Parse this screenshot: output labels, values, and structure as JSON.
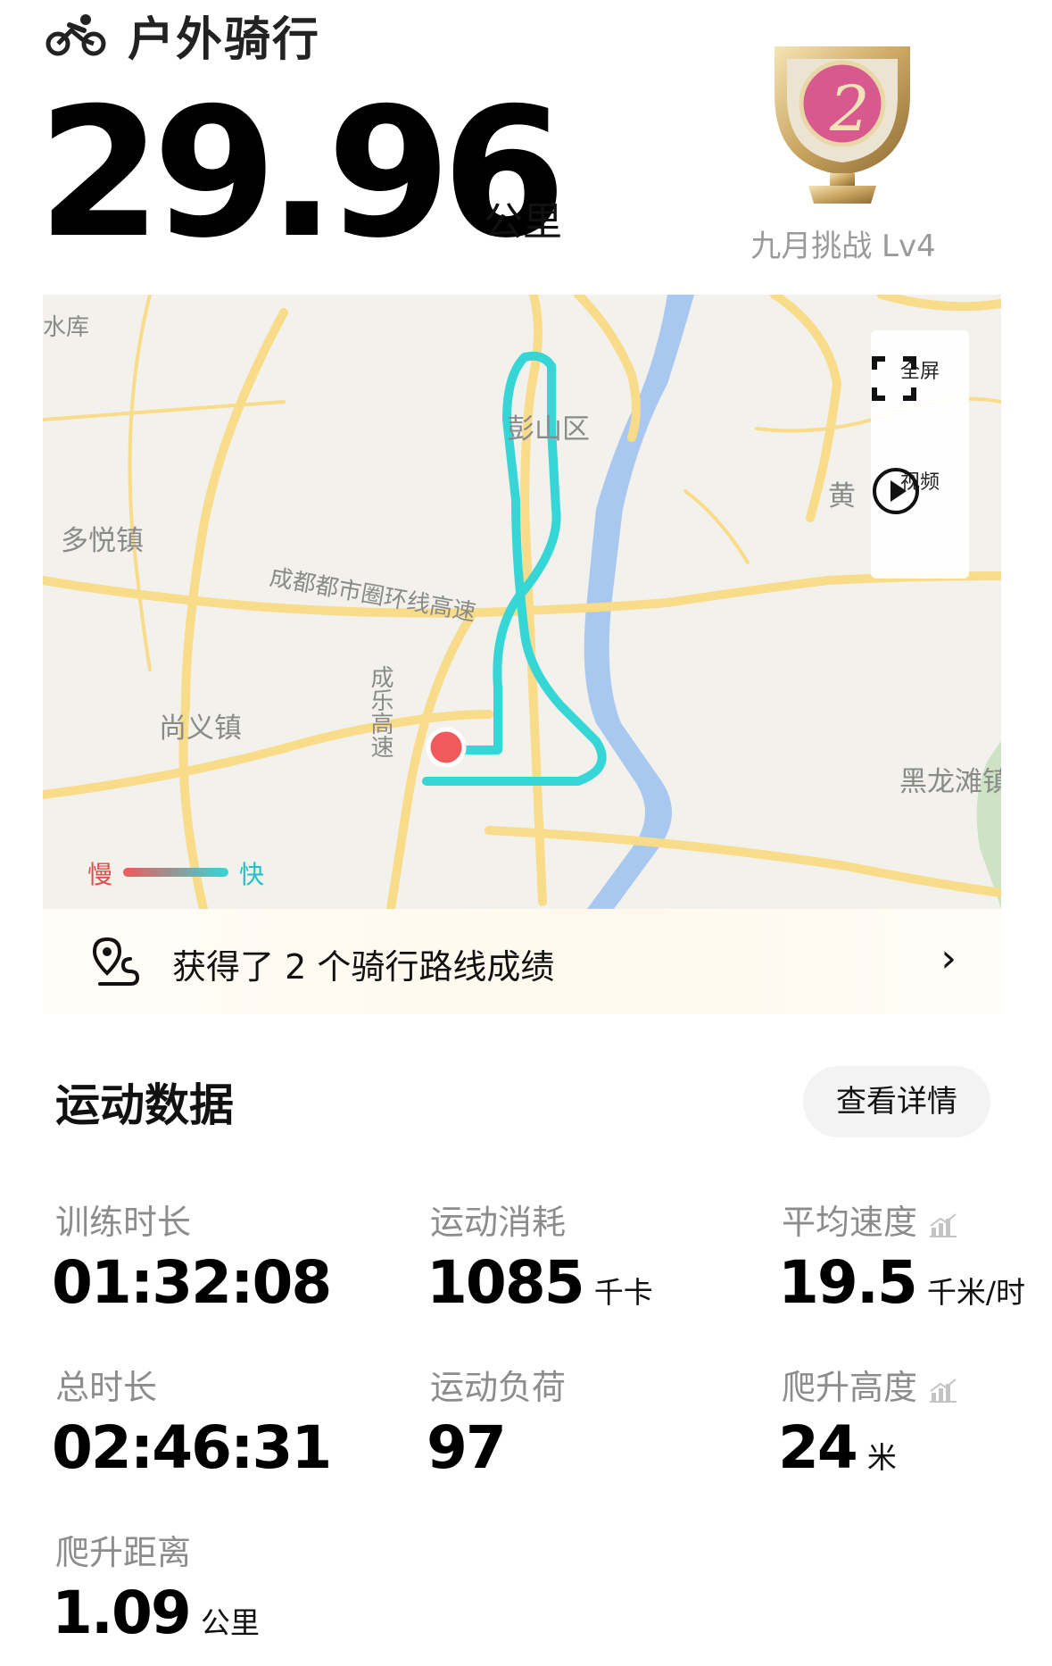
{
  "header": {
    "activity_type": "户外骑行",
    "distance_value": "29.96",
    "distance_unit": "公里"
  },
  "challenge": {
    "label": "九月挑战 Lv4",
    "icon": "trophy-icon"
  },
  "map": {
    "labels": {
      "reservoir": "水库",
      "pengshan": "彭山区",
      "duoyue": "多悦镇",
      "ring_highway": "成都都市圈环线高速",
      "chengle_highway": "成乐高速",
      "shangyi": "尚义镇",
      "huang": "黄",
      "heilongtan": "黑龙滩镇"
    },
    "controls": {
      "fullscreen_label": "全屏",
      "video_label": "视频"
    },
    "legend": {
      "slow": "慢",
      "fast": "快"
    },
    "colors": {
      "route": "#36d6d6",
      "start_point": "#f05a5a",
      "road": "#f8dc8a",
      "water": "#a9c8f0"
    }
  },
  "achievement": {
    "text": "获得了 2 个骑行路线成绩",
    "icon": "route-pin-icon"
  },
  "stats": {
    "section_title": "运动数据",
    "details_button": "查看详情",
    "training_duration": {
      "label": "训练时长",
      "value": "01:32:08"
    },
    "calories": {
      "label": "运动消耗",
      "value": "1085",
      "unit": "千卡"
    },
    "avg_speed": {
      "label": "平均速度",
      "value": "19.5",
      "unit": "千米/时"
    },
    "total_duration": {
      "label": "总时长",
      "value": "02:46:31"
    },
    "training_load": {
      "label": "运动负荷",
      "value": "97"
    },
    "elevation_gain": {
      "label": "爬升高度",
      "value": "24",
      "unit": "米"
    },
    "climb_distance": {
      "label": "爬升距离",
      "value": "1.09",
      "unit": "公里"
    }
  }
}
